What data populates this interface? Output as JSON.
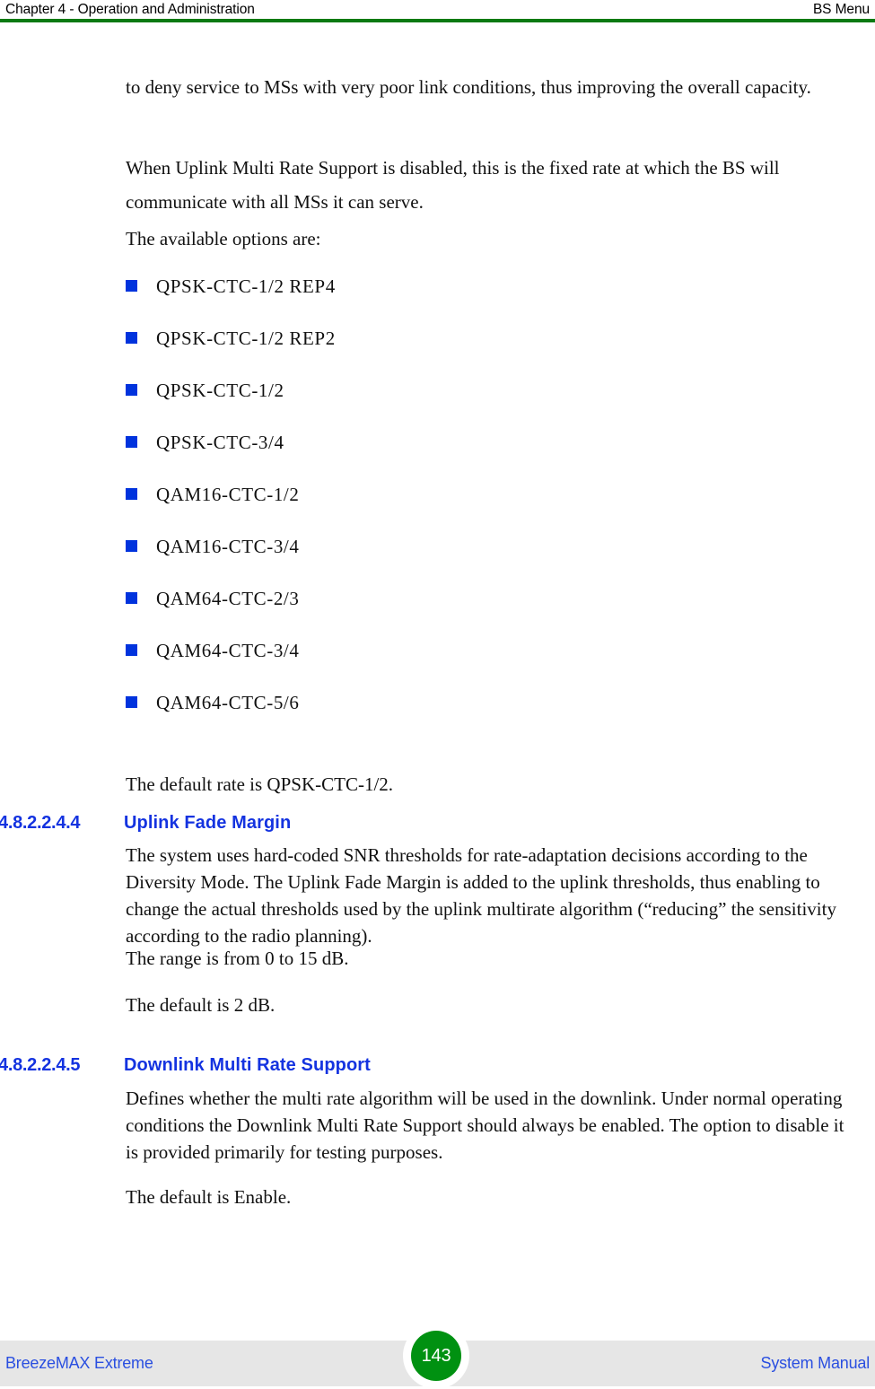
{
  "header": {
    "left_text": "Chapter 4 - Operation and Administration",
    "right_text": "BS Menu",
    "rule_color": "#0a7a12"
  },
  "body": {
    "paragraphs": [
      {
        "id": "p-deny-service",
        "text": "to deny service to MSs with very poor link conditions, thus improving the overall capacity."
      },
      {
        "id": "p-uplink-disabled",
        "text": "When Uplink Multi Rate Support is disabled, this is the fixed rate at which the BS will communicate with all MSs it can serve."
      },
      {
        "id": "p-available-options",
        "text": "The available options are:"
      },
      {
        "id": "p-default-rate",
        "text": "The default rate is QPSK-CTC-1/2."
      },
      {
        "id": "p-fade-margin-desc",
        "text": "The system uses hard-coded SNR thresholds for rate-adaptation decisions according to the Diversity Mode. The Uplink Fade Margin is added to the uplink thresholds, thus enabling to change the actual thresholds used by the uplink multirate algorithm (“reducing” the sensitivity according to the radio planning)."
      },
      {
        "id": "p-range",
        "text": "The range is from 0 to 15 dB."
      },
      {
        "id": "p-default-2db",
        "text": "The default is 2 dB."
      },
      {
        "id": "p-downlink-desc",
        "text": "Defines whether the multi rate algorithm will be used in the downlink. Under normal operating conditions the Downlink Multi Rate Support should always be enabled. The option to disable it is provided primarily for testing purposes."
      },
      {
        "id": "p-default-enable",
        "text": "The default is Enable."
      }
    ],
    "rate_options": [
      "QPSK-CTC-1/2 REP4",
      "QPSK-CTC-1/2 REP2",
      "QPSK-CTC-1/2",
      "QPSK-CTC-3/4",
      "QAM16-CTC-1/2",
      "QAM16-CTC-3/4",
      "QAM64-CTC-2/3",
      "QAM64-CTC-3/4",
      "QAM64-CTC-5/6"
    ],
    "bullet_color": "#0033dd",
    "headings": [
      {
        "number": "4.8.2.2.4.4",
        "title": "Uplink Fade Margin"
      },
      {
        "number": "4.8.2.2.4.5",
        "title": "Downlink Multi Rate Support"
      }
    ],
    "heading_color": "#1433e0"
  },
  "footer": {
    "left_text": "BreezeMAX Extreme",
    "page_number": "143",
    "right_text": "System Manual",
    "badge_color": "#009111",
    "band_color": "#e6e6e6",
    "text_color": "#2a4fe0"
  }
}
